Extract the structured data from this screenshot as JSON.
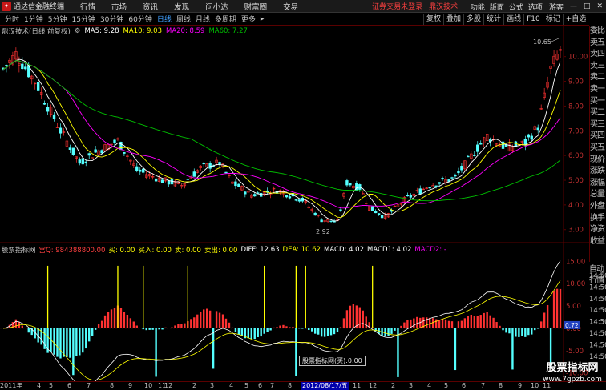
{
  "app": {
    "title": "通达信金融终端",
    "menu": [
      "行情",
      "市场",
      "资讯",
      "发现",
      "问小达",
      "财富圈",
      "交易"
    ],
    "status": "证券交易未登录",
    "stock_name": "鼎汉技术",
    "right_menu": [
      "功能",
      "版面",
      "公式",
      "选项"
    ],
    "window_label": "游客"
  },
  "periods": {
    "items": [
      "分时",
      "1分钟",
      "5分钟",
      "15分钟",
      "30分钟",
      "60分钟",
      "日线",
      "周线",
      "月线",
      "多周期",
      "更多"
    ],
    "active": "日线"
  },
  "tools": [
    "复权",
    "叠加",
    "多股",
    "统计",
    "画线",
    "F10",
    "标记",
    "+自选"
  ],
  "main_chart": {
    "header": "鼎汉技术(日线 前复权)",
    "ma": [
      {
        "label": "MA5: 9.28",
        "color": "#ffffff"
      },
      {
        "label": "MA10: 9.03",
        "color": "#ffff00"
      },
      {
        "label": "MA20: 8.59",
        "color": "#ff00ff"
      },
      {
        "label": "MA60: 7.27",
        "color": "#00c000"
      }
    ],
    "y_ticks": [
      "10.00",
      "9.00",
      "8.00",
      "7.00",
      "6.00",
      "5.00",
      "4.00",
      "3.00"
    ],
    "high_label": "10.65",
    "low_label": "2.92"
  },
  "side_panel": [
    "委比",
    "卖五",
    "卖四",
    "卖三",
    "卖二",
    "卖一",
    "买一",
    "买二",
    "买三",
    "买四",
    "买五",
    "现价",
    "涨跌",
    "涨幅",
    "总量",
    "外盘",
    "换手",
    "净资",
    "收益"
  ],
  "side_panel2": [
    "自动",
    "行情"
  ],
  "indicator": {
    "name": "股票指标网",
    "values": [
      {
        "label": "宫Q: 984388800.00",
        "color": "#ff4040"
      },
      {
        "label": "买: 0.00",
        "color": "#ffff00"
      },
      {
        "label": "买入: 0.00",
        "color": "#ffff00"
      },
      {
        "label": "卖: 0.00",
        "color": "#ffff00"
      },
      {
        "label": "卖出: 0.00",
        "color": "#ffff00"
      },
      {
        "label": "DIFF: 12.63",
        "color": "#ffffff"
      },
      {
        "label": "DEA: 10.62",
        "color": "#ffff00"
      },
      {
        "label": "MACD: 4.02",
        "color": "#ffffff"
      },
      {
        "label": "MACD1: 4.02",
        "color": "#ffffff"
      },
      {
        "label": "MACD2: -",
        "color": "#ff00ff"
      }
    ],
    "y_ticks": [
      "15.00",
      "10.00",
      "5.00",
      "0.00",
      "-5.00",
      "-10.00"
    ],
    "current_value": "0.72",
    "right_times": [
      "14:50",
      "14:50",
      "14:50",
      "14:50",
      "14:50",
      "14:50",
      "14:50",
      "14:50"
    ],
    "tooltip": "股票指标网(买):0.00"
  },
  "date_axis": {
    "labels": [
      "2011年",
      "4",
      "5",
      "6",
      "7",
      "8",
      "9",
      "10",
      "11",
      "12",
      "2",
      "3",
      "4",
      "5",
      "6",
      "7",
      "8",
      "2012/08/17/五",
      "11",
      "12",
      "2",
      "3",
      "4",
      "5",
      "6",
      "7",
      "8",
      "9",
      "10",
      "11"
    ],
    "highlight": "2012/08/17/五"
  },
  "watermark": {
    "line1": "股票指标网",
    "line2": "www.7gpzb.com"
  },
  "colors": {
    "up": "#ff3232",
    "down": "#54ffff",
    "ma5": "#ffffff",
    "ma10": "#ffff00",
    "ma20": "#ff00ff",
    "ma60": "#00c000",
    "border": "#5a0000"
  }
}
